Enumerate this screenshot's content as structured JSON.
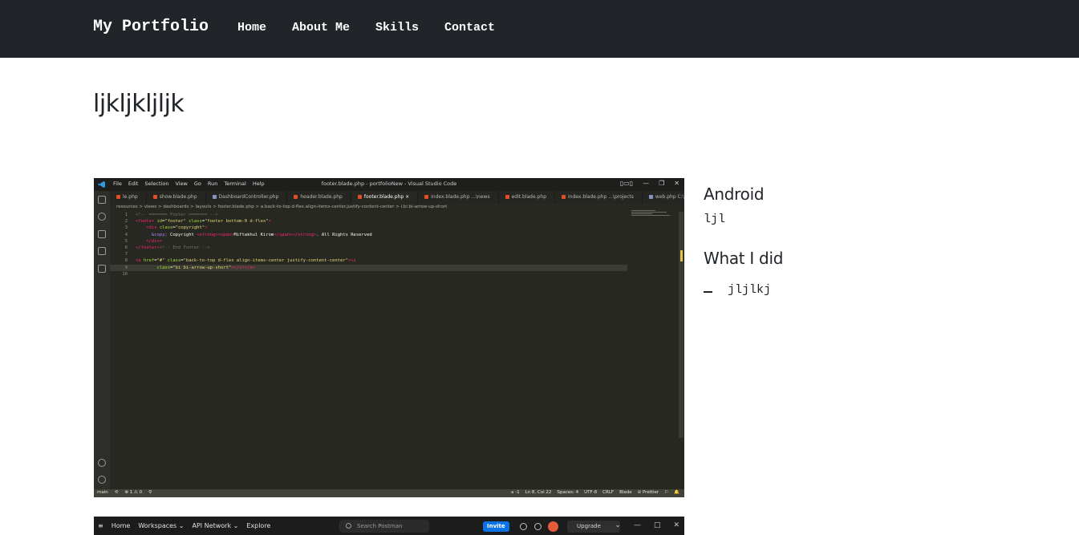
{
  "navbar": {
    "brand": "My Portfolio",
    "links": [
      "Home",
      "About Me",
      "Skills",
      "Contact"
    ]
  },
  "page": {
    "title": "ljkljkljljk"
  },
  "sidebar": {
    "category_heading": "Android",
    "category_text": "ljl",
    "did_heading": "What I did",
    "did_items": [
      "jljlkj"
    ]
  },
  "screenshot_vscode": {
    "menu": [
      "File",
      "Edit",
      "Selection",
      "View",
      "Go",
      "Run",
      "Terminal",
      "Help"
    ],
    "window_title": "footer.blade.php - portfolioNew - Visual Studio Code",
    "tabs": [
      {
        "label": "le.php",
        "color": "#e44d26"
      },
      {
        "label": "show.blade.php",
        "color": "#e44d26"
      },
      {
        "label": "DashboardController.php",
        "color": "#8892bf"
      },
      {
        "label": "header.blade.php",
        "color": "#e44d26"
      },
      {
        "label": "footer.blade.php ×",
        "color": "#e44d26"
      },
      {
        "label": "index.blade.php ...\\news",
        "color": "#e44d26"
      },
      {
        "label": "edit.blade.php",
        "color": "#e44d26"
      },
      {
        "label": "index.blade.php ...\\projects",
        "color": "#e44d26"
      },
      {
        "label": "web.php C:\\...\\routes\\web.php",
        "color": "#8892bf"
      }
    ],
    "breadcrumb": "resources > views > dashboards > layouts > footer.blade.php > a.back-to-top.d-flex.align-items-center.justify-content-center > i.bi.bi-arrow-up-short",
    "code_lines": [
      {
        "n": "1",
        "html": "<span class='c-com'>&lt;!-- ======= Footer ======= --&gt;</span>"
      },
      {
        "n": "2",
        "html": "<span class='c-tag'>&lt;footer</span> <span class='c-attr'>id</span>=<span class='c-str'>\"footer\"</span> <span class='c-attr'>class</span>=<span class='c-str'>\"footer bottom-0 d-flex\"</span><span class='c-tag'>&gt;</span>"
      },
      {
        "n": "3",
        "html": "    <span class='c-tag'>&lt;div</span> <span class='c-attr'>class</span>=<span class='c-str'>\"copyright\"</span><span class='c-tag'>&gt;</span>"
      },
      {
        "n": "4",
        "html": "      <span class='c-ent'>&amp;copy;</span> Copyright <span class='c-tag'>&lt;strong&gt;&lt;span&gt;</span>Miftakhul Kirom<span class='c-tag'>&lt;/span&gt;&lt;/strong&gt;</span>. All Rights Reserved"
      },
      {
        "n": "5",
        "html": "    <span class='c-tag'>&lt;/div&gt;</span>"
      },
      {
        "n": "6",
        "html": "<span class='c-tag'>&lt;/footer&gt;</span><span class='c-com'>&lt;!-- End Footer --&gt;</span>"
      },
      {
        "n": "7",
        "html": ""
      },
      {
        "n": "8",
        "html": "<span class='c-tag'>&lt;a</span> <span class='c-attr'>href</span>=<span class='c-str'>\"#\"</span> <span class='c-attr'>class</span>=<span class='c-str'>\"back-to-top d-flex align-items-center justify-content-center\"</span><span class='c-tag'>&gt;&lt;i</span>"
      },
      {
        "n": "9",
        "html": "        <span class='c-attr'>class</span>=<span class='c-str'>\"bi bi-arrow-up-short\"</span><span class='c-tag'>&gt;&lt;/i&gt;&lt;/a&gt;</span>"
      },
      {
        "n": "10",
        "html": ""
      }
    ],
    "status_left": [
      "main",
      "⟲",
      "⊗ 1 ⚠ 0",
      "⚲"
    ],
    "status_right": [
      "a -1",
      "Ln 8, Col 22",
      "Spaces: 4",
      "UTF-8",
      "CRLF",
      "Blade",
      "⊘ Prettier",
      "⚐",
      "🔔"
    ]
  },
  "screenshot_postman": {
    "menu": [
      "≡",
      "Home",
      "Workspaces ⌄",
      "API Network ⌄",
      "Explore"
    ],
    "search_placeholder": "Search Postman",
    "invite_label": "Invite",
    "upgrade_label": "Upgrade",
    "window_controls": [
      "⌄",
      "—",
      "□",
      "✕"
    ]
  }
}
